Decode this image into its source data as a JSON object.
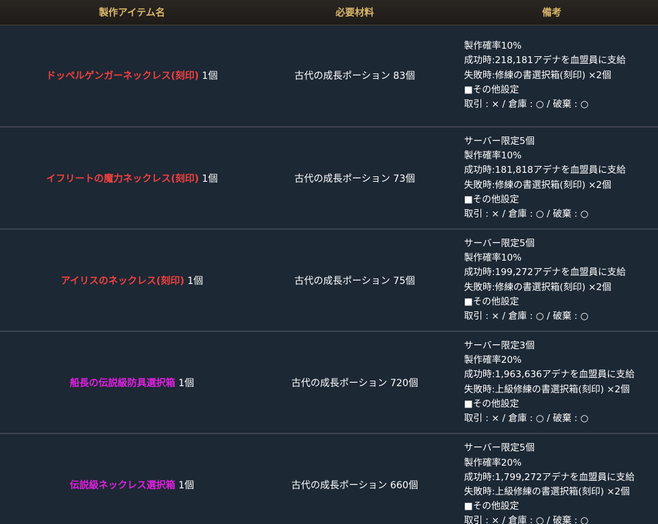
{
  "colors": {
    "header_bg": "#231f1c",
    "header_text": "#d9b66b",
    "row_bg": "#1c2834",
    "row_divider": "#3c4450",
    "name_red": "#f04040",
    "name_magenta": "#e020e0",
    "text": "#ffffff"
  },
  "header": {
    "col_name": "製作アイテム名",
    "col_material": "必要材料",
    "col_notes": "備考"
  },
  "rows": [
    {
      "name": "ドッペルゲンガーネックレス(刻印)",
      "name_color": "red",
      "qty": "1個",
      "material": "古代の成長ポーション 83個",
      "notes": [
        "製作確率10%",
        "成功時:218,181アデナを血盟員に支給",
        "失敗時:修練の書選択箱(刻印) ×2個",
        "■その他設定",
        "取引 : × / 倉庫 : ○ / 破棄 : ○"
      ]
    },
    {
      "name": "イフリートの魔力ネックレス(刻印)",
      "name_color": "red",
      "qty": "1個",
      "material": "古代の成長ポーション 73個",
      "notes": [
        "サーバー限定5個",
        "製作確率10%",
        "成功時:181,818アデナを血盟員に支給",
        "失敗時:修練の書選択箱(刻印) ×2個",
        "■その他設定",
        "取引 : × / 倉庫 : ○ / 破棄 : ○"
      ]
    },
    {
      "name": "アイリスのネックレス(刻印)",
      "name_color": "red",
      "qty": "1個",
      "material": "古代の成長ポーション 75個",
      "notes": [
        "サーバー限定5個",
        "製作確率10%",
        "成功時:199,272アデナを血盟員に支給",
        "失敗時:修練の書選択箱(刻印) ×2個",
        "■その他設定",
        "取引 : × / 倉庫 : ○ / 破棄 : ○"
      ]
    },
    {
      "name": "船長の伝説級防具選択箱",
      "name_color": "magenta",
      "qty": "1個",
      "material": "古代の成長ポーション 720個",
      "notes": [
        "サーバー限定3個",
        "製作確率20%",
        "成功時:1,963,636アデナを血盟員に支給",
        "失敗時:上級修練の書選択箱(刻印) ×2個",
        "■その他設定",
        "取引 : × / 倉庫 : ○ / 破棄 : ○"
      ]
    },
    {
      "name": "伝説級ネックレス選択箱",
      "name_color": "magenta",
      "qty": "1個",
      "material": "古代の成長ポーション 660個",
      "notes": [
        "サーバー限定5個",
        "製作確率20%",
        "成功時:1,799,272アデナを血盟員に支給",
        "失敗時:上級修練の書選択箱(刻印) ×2個",
        "■その他設定",
        "取引 : × / 倉庫 : ○ / 破棄 : ○"
      ]
    }
  ]
}
